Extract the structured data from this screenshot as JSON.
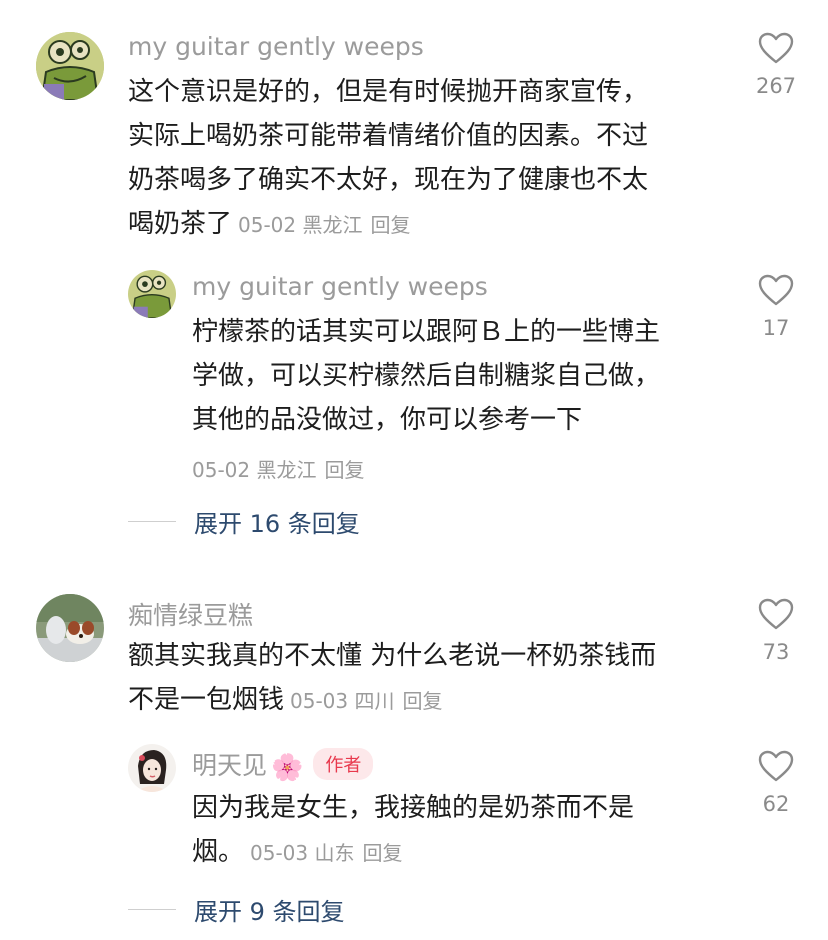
{
  "comments": [
    {
      "username": "my guitar gently weeps",
      "text": "这个意识是好的，但是有时候抛开商家宣传，实际上喝奶茶可能带着情绪价值的因素。不过奶茶喝多了确实不太好，现在为了健康也不太喝奶茶了",
      "lines": [
        "这个意识是好的，但是有时候抛开商家宣传，",
        "实际上喝奶茶可能带着情绪价值的因素。不过",
        "奶茶喝多了确实不太好，现在为了健康也不太",
        "喝奶茶了"
      ],
      "date": "05-02",
      "location": "黑龙江",
      "reply_label": "回复",
      "likes": "267",
      "reply": {
        "username": "my guitar gently weeps",
        "lines": [
          "柠檬茶的话其实可以跟阿Ｂ上的一些博主",
          "学做，可以买柠檬然后自制糖浆自己做，",
          "其他的品没做过，你可以参考一下"
        ],
        "date": "05-02",
        "location": "黑龙江",
        "reply_label": "回复",
        "likes": "17"
      },
      "expand_label": "展开 16 条回复"
    },
    {
      "username": "痴情绿豆糕",
      "lines": [
        "额其实我真的不太懂 为什么老说一杯奶茶钱而",
        "不是一包烟钱"
      ],
      "date": "05-03",
      "location": "四川",
      "reply_label": "回复",
      "likes": "73",
      "reply": {
        "username": "明天见",
        "badge": "作者",
        "lines": [
          "因为我是女生，我接触的是奶茶而不是",
          "烟。"
        ],
        "date": "05-03",
        "location": "山东",
        "reply_label": "回复",
        "likes": "62"
      },
      "expand_label": "展开 9 条回复"
    }
  ],
  "icons": {
    "like": "heart-outline-icon",
    "flower": "flower-emoji-icon"
  },
  "colors": {
    "username": "#9b9b9b",
    "expand": "#2d4a6e",
    "badge_bg": "#fde8ea",
    "badge_text": "#e8394d"
  }
}
